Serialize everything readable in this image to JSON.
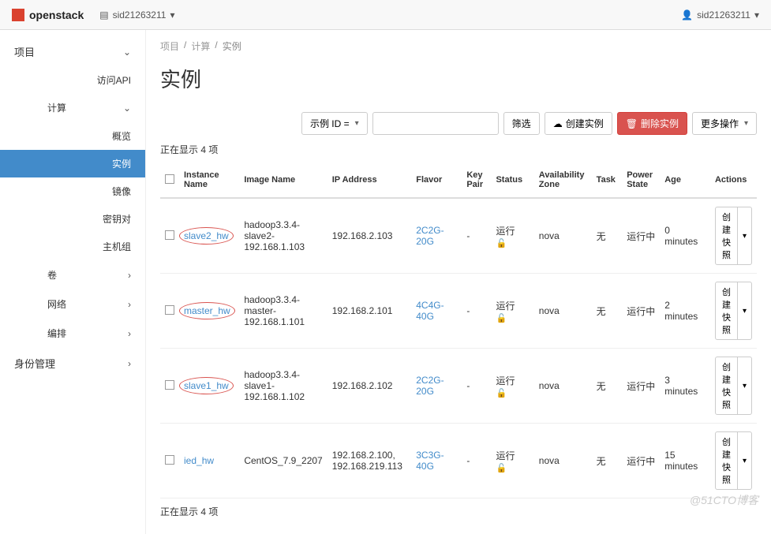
{
  "header": {
    "brand": "openstack",
    "project": "sid21263211",
    "user": "sid21263211"
  },
  "sidebar": {
    "project": "项目",
    "access_api": "访问API",
    "compute": "计算",
    "overview": "概览",
    "instances": "实例",
    "images": "镜像",
    "keypairs": "密钥对",
    "hostgroups": "主机组",
    "volumes": "卷",
    "network": "网络",
    "orchestration": "编排",
    "identity": "身份管理"
  },
  "breadcrumb": {
    "project": "项目",
    "compute": "计算",
    "instances": "实例"
  },
  "page_title": "实例",
  "filter": {
    "label": "示例 ID =",
    "placeholder": "",
    "btn": "筛选"
  },
  "actions": {
    "create": "创建实例",
    "delete": "删除实例",
    "more": "更多操作"
  },
  "showing": "正在显示 4 项",
  "columns": {
    "name": "Instance Name",
    "image": "Image Name",
    "ip": "IP Address",
    "flavor": "Flavor",
    "keypair": "Key Pair",
    "status": "Status",
    "az": "Availability Zone",
    "task": "Task",
    "power": "Power State",
    "age": "Age",
    "actions": "Actions"
  },
  "rows": [
    {
      "name": "slave2_hw",
      "circled": true,
      "image": "hadoop3.3.4-slave2-192.168.1.103",
      "ip": "192.168.2.103",
      "flavor": "2C2G-20G",
      "keypair": "-",
      "status": "运行",
      "az": "nova",
      "task": "无",
      "power": "运行中",
      "age": "0 minutes",
      "action": "创建快照"
    },
    {
      "name": "master_hw",
      "circled": true,
      "image": "hadoop3.3.4-master-192.168.1.101",
      "ip": "192.168.2.101",
      "flavor": "4C4G-40G",
      "keypair": "-",
      "status": "运行",
      "az": "nova",
      "task": "无",
      "power": "运行中",
      "age": "2 minutes",
      "action": "创建快照"
    },
    {
      "name": "slave1_hw",
      "circled": true,
      "image": "hadoop3.3.4-slave1-192.168.1.102",
      "ip": "192.168.2.102",
      "flavor": "2C2G-20G",
      "keypair": "-",
      "status": "运行",
      "az": "nova",
      "task": "无",
      "power": "运行中",
      "age": "3 minutes",
      "action": "创建快照"
    },
    {
      "name": "ied_hw",
      "circled": false,
      "image": "CentOS_7.9_2207",
      "ip": "192.168.2.100, 192.168.219.113",
      "flavor": "3C3G-40G",
      "keypair": "-",
      "status": "运行",
      "az": "nova",
      "task": "无",
      "power": "运行中",
      "age": "15 minutes",
      "action": "创建快照"
    }
  ],
  "watermark": "@51CTO博客"
}
